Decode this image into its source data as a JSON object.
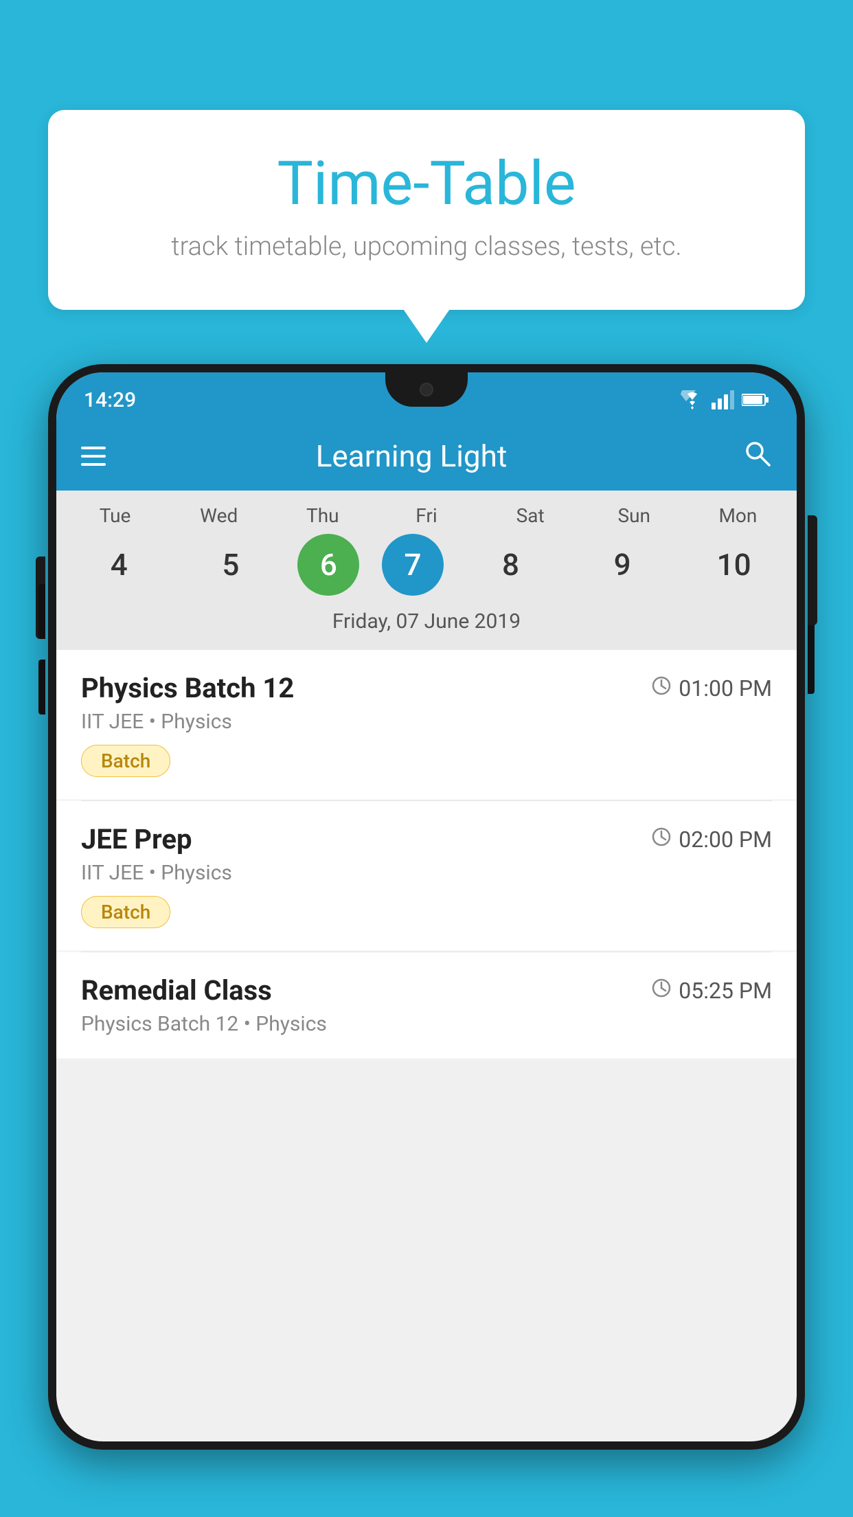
{
  "background_color": "#29B6D9",
  "bubble": {
    "title": "Time-Table",
    "subtitle": "track timetable, upcoming classes, tests, etc."
  },
  "phone": {
    "status_bar": {
      "time": "14:29"
    },
    "app_bar": {
      "title": "Learning Light"
    },
    "calendar": {
      "days": [
        {
          "label": "Tue",
          "num": "4",
          "state": "normal"
        },
        {
          "label": "Wed",
          "num": "5",
          "state": "normal"
        },
        {
          "label": "Thu",
          "num": "6",
          "state": "today"
        },
        {
          "label": "Fri",
          "num": "7",
          "state": "selected"
        },
        {
          "label": "Sat",
          "num": "8",
          "state": "normal"
        },
        {
          "label": "Sun",
          "num": "9",
          "state": "normal"
        },
        {
          "label": "Mon",
          "num": "10",
          "state": "normal"
        }
      ],
      "selected_date_label": "Friday, 07 June 2019"
    },
    "classes": [
      {
        "name": "Physics Batch 12",
        "time": "01:00 PM",
        "meta": "IIT JEE • Physics",
        "tag": "Batch"
      },
      {
        "name": "JEE Prep",
        "time": "02:00 PM",
        "meta": "IIT JEE • Physics",
        "tag": "Batch"
      },
      {
        "name": "Remedial Class",
        "time": "05:25 PM",
        "meta": "Physics Batch 12 • Physics",
        "tag": ""
      }
    ]
  }
}
